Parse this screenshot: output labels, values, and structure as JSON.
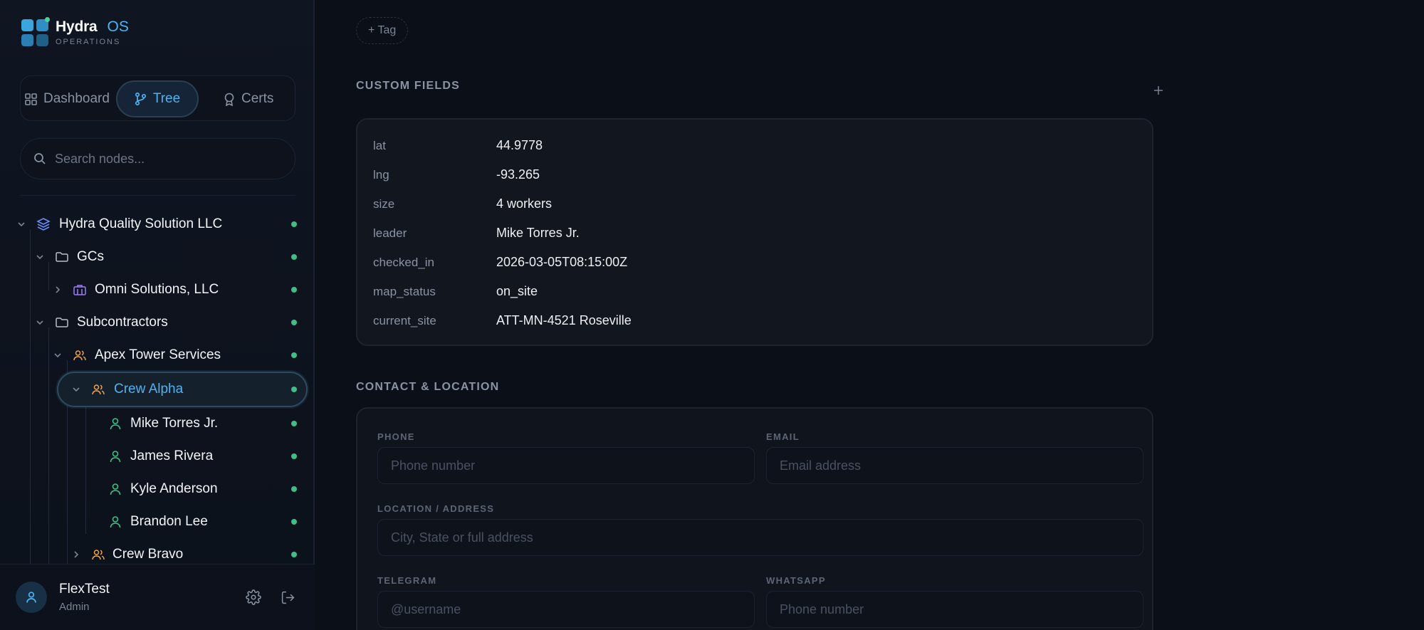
{
  "app": {
    "name": "Hydra",
    "suffix": "OS",
    "subtitle": "OPERATIONS"
  },
  "nav": {
    "dashboard": "Dashboard",
    "tree": "Tree",
    "certs": "Certs",
    "active": "Tree"
  },
  "search": {
    "placeholder": "Search nodes..."
  },
  "tree": [
    {
      "label": "Hydra Quality Solution LLC",
      "icon": "layers-icon",
      "expanded": true,
      "status": "active"
    },
    {
      "label": "GCs",
      "icon": "folder-icon",
      "expanded": true,
      "status": "active"
    },
    {
      "label": "Omni Solutions, LLC",
      "icon": "briefcase-icon",
      "expanded": false,
      "status": "active"
    },
    {
      "label": "Subcontractors",
      "icon": "folder-icon",
      "expanded": true,
      "status": "active"
    },
    {
      "label": "Apex Tower Services",
      "icon": "users-icon",
      "expanded": true,
      "status": "active"
    },
    {
      "label": "Crew Alpha",
      "icon": "users-icon",
      "expanded": true,
      "status": "active",
      "selected": true
    },
    {
      "label": "Mike Torres Jr.",
      "icon": "user-icon",
      "status": "active"
    },
    {
      "label": "James Rivera",
      "icon": "user-icon",
      "status": "active"
    },
    {
      "label": "Kyle Anderson",
      "icon": "user-icon",
      "status": "active"
    },
    {
      "label": "Brandon Lee",
      "icon": "user-icon",
      "status": "active"
    },
    {
      "label": "Crew Bravo",
      "icon": "users-icon",
      "expanded": false,
      "status": "active"
    }
  ],
  "user": {
    "name": "FlexTest",
    "role": "Admin"
  },
  "tags": {
    "add_label": "+ Tag"
  },
  "custom_fields": {
    "title": "CUSTOM FIELDS",
    "add_icon": "plus-icon",
    "rows": [
      {
        "key": "lat",
        "value": "44.9778"
      },
      {
        "key": "lng",
        "value": "-93.265"
      },
      {
        "key": "size",
        "value": "4 workers"
      },
      {
        "key": "leader",
        "value": "Mike Torres Jr."
      },
      {
        "key": "checked_in",
        "value": "2026-03-05T08:15:00Z"
      },
      {
        "key": "map_status",
        "value": "on_site"
      },
      {
        "key": "current_site",
        "value": "ATT-MN-4521 Roseville"
      }
    ]
  },
  "contact": {
    "title": "CONTACT & LOCATION",
    "phone": {
      "label": "PHONE",
      "placeholder": "Phone number",
      "value": ""
    },
    "email": {
      "label": "EMAIL",
      "placeholder": "Email address",
      "value": ""
    },
    "location": {
      "label": "LOCATION / ADDRESS",
      "placeholder": "City, State or full address",
      "value": ""
    },
    "telegram": {
      "label": "TELEGRAM",
      "placeholder": "@username",
      "value": ""
    },
    "whatsapp": {
      "label": "WHATSAPP",
      "placeholder": "Phone number",
      "value": ""
    }
  },
  "colors": {
    "accent": "#4fb3ef",
    "status_active": "#3fbf86",
    "group_icon": "#f0a24a",
    "person_icon": "#3fbf86",
    "org_icon": "#6b8cff",
    "client_icon": "#a07bff"
  }
}
